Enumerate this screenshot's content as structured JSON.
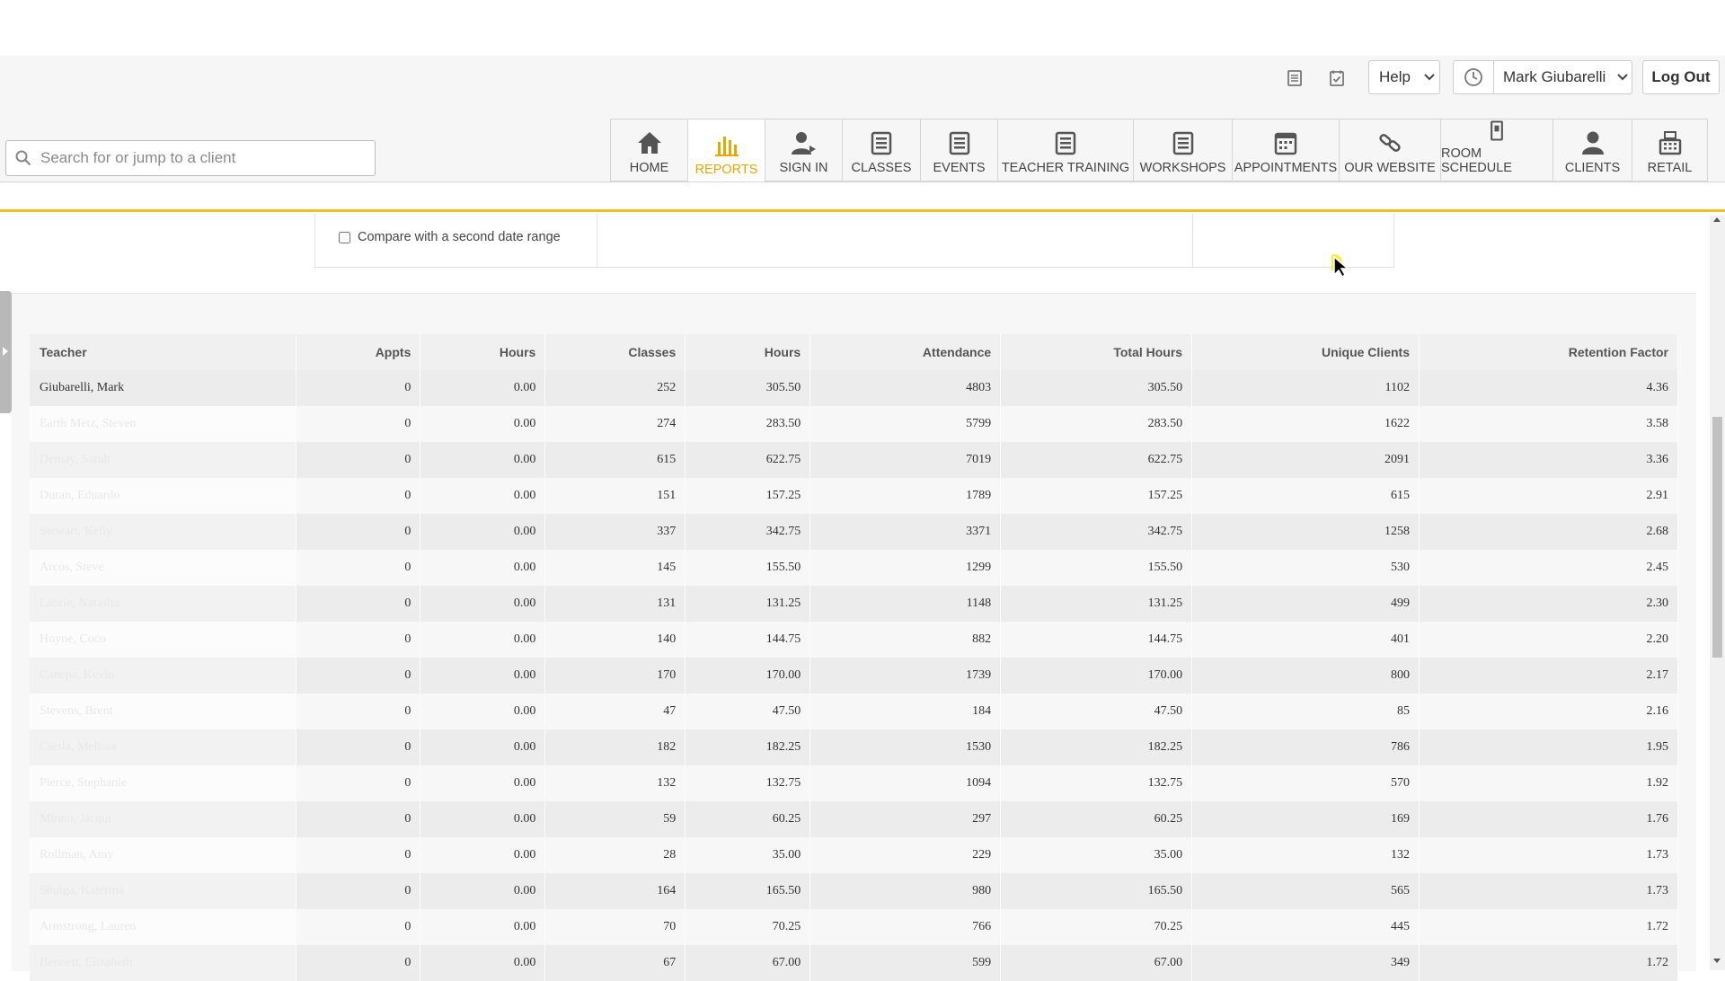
{
  "header": {
    "help_label": "Help",
    "user_name": "Mark Giubarelli",
    "logout_label": "Log Out"
  },
  "search": {
    "placeholder": "Search for or jump to a client"
  },
  "nav": {
    "home": "HOME",
    "reports": "REPORTS",
    "sign_in": "SIGN IN",
    "classes": "CLASSES",
    "events": "EVENTS",
    "teacher_training": "TEACHER TRAINING",
    "workshops": "WORKSHOPS",
    "appointments": "APPOINTMENTS",
    "our_website": "OUR WEBSITE",
    "room_schedule": "ROOM SCHEDULE",
    "clients": "CLIENTS",
    "retail": "RETAIL"
  },
  "filter": {
    "compare_label": "Compare with a second date range"
  },
  "table": {
    "headers": [
      "Teacher",
      "Appts",
      "Hours",
      "Classes",
      "Hours",
      "Attendance",
      "Total Hours",
      "Unique Clients",
      "Retention Factor"
    ],
    "rows": [
      [
        "Giubarelli, Mark",
        "0",
        "0.00",
        "252",
        "305.50",
        "4803",
        "305.50",
        "1102",
        "4.36"
      ],
      [
        "Earth Metz, Steven",
        "0",
        "0.00",
        "274",
        "283.50",
        "5799",
        "283.50",
        "1622",
        "3.58"
      ],
      [
        "Demay, Sarah",
        "0",
        "0.00",
        "615",
        "622.75",
        "7019",
        "622.75",
        "2091",
        "3.36"
      ],
      [
        "Duran, Eduardo",
        "0",
        "0.00",
        "151",
        "157.25",
        "1789",
        "157.25",
        "615",
        "2.91"
      ],
      [
        "Stewart, Kelly",
        "0",
        "0.00",
        "337",
        "342.75",
        "3371",
        "342.75",
        "1258",
        "2.68"
      ],
      [
        "Arcos, Steve",
        "0",
        "0.00",
        "145",
        "155.50",
        "1299",
        "155.50",
        "530",
        "2.45"
      ],
      [
        "Labrie, Natasha",
        "0",
        "0.00",
        "131",
        "131.25",
        "1148",
        "131.25",
        "499",
        "2.30"
      ],
      [
        "Hoyne, Coco",
        "0",
        "0.00",
        "140",
        "144.75",
        "882",
        "144.75",
        "401",
        "2.20"
      ],
      [
        "Canepa, Kevin",
        "0",
        "0.00",
        "170",
        "170.00",
        "1739",
        "170.00",
        "800",
        "2.17"
      ],
      [
        "Stevens, Brent",
        "0",
        "0.00",
        "47",
        "47.50",
        "184",
        "47.50",
        "85",
        "2.16"
      ],
      [
        "Ciesla, Melissa",
        "0",
        "0.00",
        "182",
        "182.25",
        "1530",
        "182.25",
        "786",
        "1.95"
      ],
      [
        "Pierce, Stephanie",
        "0",
        "0.00",
        "132",
        "132.75",
        "1094",
        "132.75",
        "570",
        "1.92"
      ],
      [
        "Minno, Jacqui",
        "0",
        "0.00",
        "59",
        "60.25",
        "297",
        "60.25",
        "169",
        "1.76"
      ],
      [
        "Rollman, Amy",
        "0",
        "0.00",
        "28",
        "35.00",
        "229",
        "35.00",
        "132",
        "1.73"
      ],
      [
        "Shulga, Katerina",
        "0",
        "0.00",
        "164",
        "165.50",
        "980",
        "165.50",
        "565",
        "1.73"
      ],
      [
        "Armstrong, Lauren",
        "0",
        "0.00",
        "70",
        "70.25",
        "766",
        "70.25",
        "445",
        "1.72"
      ],
      [
        "Bennett, Elizabeth",
        "0",
        "0.00",
        "67",
        "67.00",
        "599",
        "67.00",
        "349",
        "1.72"
      ]
    ]
  },
  "colors": {
    "accent": "#e7a600",
    "rule": "#f0c020"
  }
}
